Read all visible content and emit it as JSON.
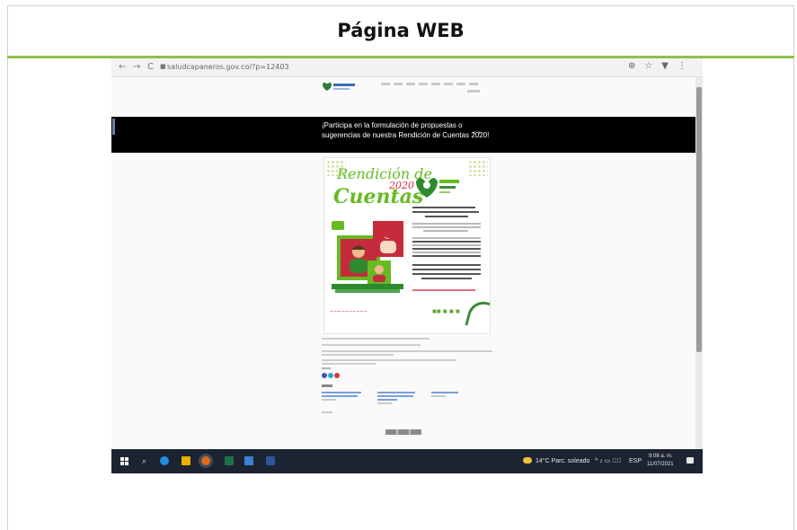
{
  "document": {
    "title": "Página WEB"
  },
  "browser": {
    "url": "saludcapaneros.gov.co/?p=12403",
    "nav": {
      "back": "←",
      "forward": "→",
      "reload": "C"
    },
    "toolbar_icons": [
      "zoom-icon",
      "star-icon",
      "extension-icon",
      "menu-icon"
    ]
  },
  "website": {
    "banner_text": "¡Participa en la formulación de propuestas o sugerencias de nuestra Rendición de Cuentas 2020!",
    "poster": {
      "title_line1": "Rendición de",
      "title_line2": "Cuentas",
      "year": "2020"
    }
  },
  "taskbar": {
    "weather": "14°C  Parc. soleado",
    "language": "ESP",
    "time": "9:08 a. m.",
    "date": "11/07/2021"
  },
  "colors": {
    "accent": "#8bc34a",
    "banner": "#000000",
    "taskbar": "#1c2331"
  }
}
